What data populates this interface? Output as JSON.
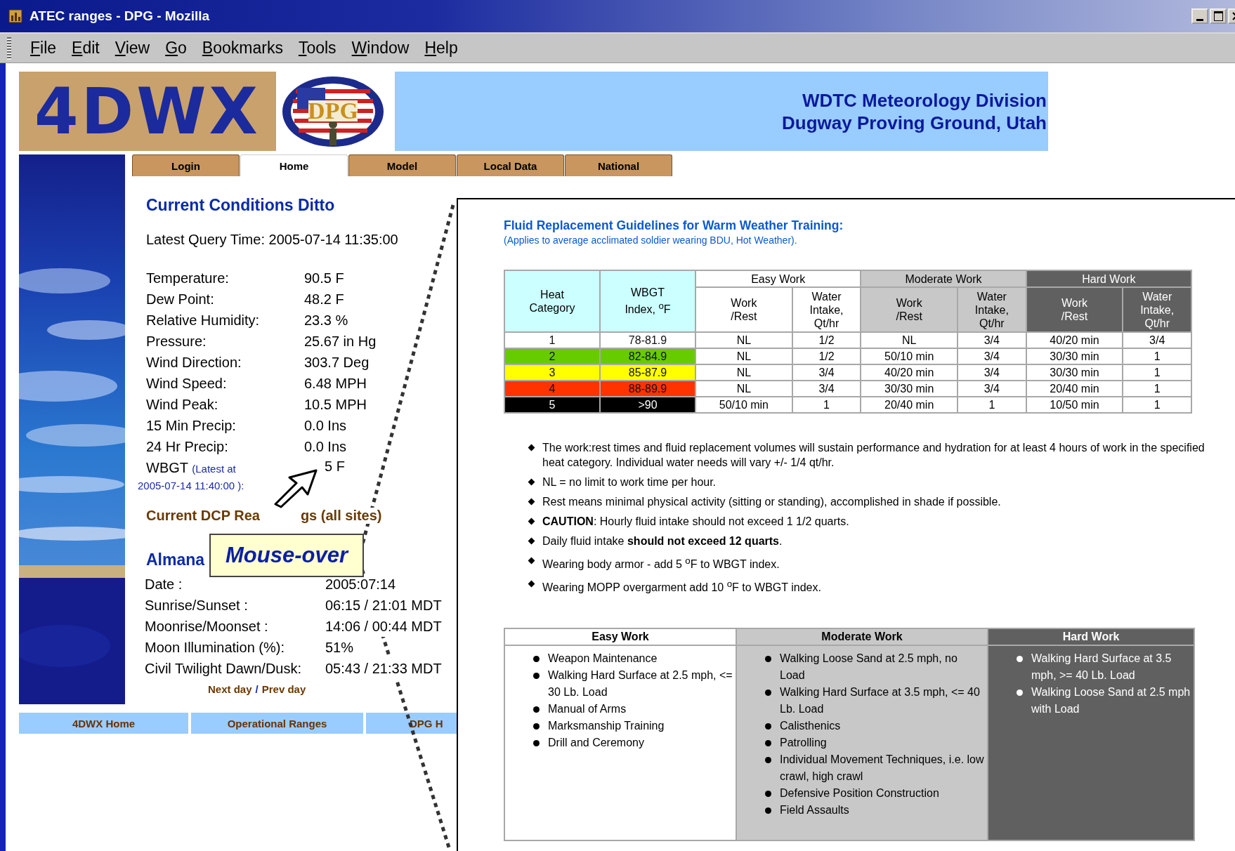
{
  "window": {
    "title": "ATEC ranges - DPG - Mozilla"
  },
  "menu": [
    "File",
    "Edit",
    "View",
    "Go",
    "Bookmarks",
    "Tools",
    "Window",
    "Help"
  ],
  "header": {
    "logo": "4DWX",
    "seal_text": "DPG",
    "banner": [
      "WDTC Meteorology Division",
      "Dugway Proving Ground, Utah"
    ]
  },
  "tabs": [
    {
      "label": "Login",
      "selected": false
    },
    {
      "label": "Home",
      "selected": true
    },
    {
      "label": "Model",
      "selected": false
    },
    {
      "label": "Local Data",
      "selected": false
    },
    {
      "label": "National",
      "selected": false
    }
  ],
  "conditions": {
    "title": "Current Conditions Ditto",
    "query_time": "Latest Query Time: 2005-07-14 11:35:00",
    "rows": [
      {
        "label": "Temperature:",
        "value": "90.5 F"
      },
      {
        "label": "Dew Point:",
        "value": "48.2 F"
      },
      {
        "label": "Relative Humidity:",
        "value": "23.3 %"
      },
      {
        "label": "Pressure:",
        "value": "25.67 in Hg"
      },
      {
        "label": "Wind Direction:",
        "value": "303.7 Deg"
      },
      {
        "label": "Wind Speed:",
        "value": "6.48 MPH"
      },
      {
        "label": "Wind Peak:",
        "value": "10.5 MPH"
      },
      {
        "label": "15 Min Precip:",
        "value": "0.0 Ins"
      },
      {
        "label": "24 Hr Precip:",
        "value": "0.0 Ins"
      }
    ],
    "wbgt": {
      "label": "WBGT",
      "note_line_1": "(Latest at",
      "note_line_2": "2005-07-14 11:40:00 ):",
      "value": "5 F"
    }
  },
  "dcp_heading": [
    "Current DCP Rea",
    "gs (all sites)"
  ],
  "almanac": {
    "title": "Almana",
    "rows": [
      {
        "label": "Date :",
        "value": "2005:07:14"
      },
      {
        "label": "Sunrise/Sunset :",
        "value": "06:15 / 21:01 MDT"
      },
      {
        "label": "Moonrise/Moonset :",
        "value": "14:06 / 00:44 MDT"
      },
      {
        "label": "Moon Illumination (%):",
        "value": "51%"
      },
      {
        "label": "Civil Twilight Dawn/Dusk:",
        "value": "05:43 / 21:33 MDT"
      }
    ],
    "links": [
      "Next day",
      "Prev day"
    ],
    "separator": "/"
  },
  "bottom_nav": [
    "4DWX Home",
    "Operational Ranges",
    "DPG H"
  ],
  "callout": {
    "text": "Mouse-over"
  },
  "popup": {
    "title": "Fluid Replacement Guidelines for Warm Weather Training:",
    "subtitle": "(Applies to average acclimated soldier wearing BDU, Hot Weather).",
    "fluid_table": {
      "lead_columns": [
        "Heat\nCategory",
        "WBGT\nIndex, $^{o}$F"
      ],
      "groups": [
        {
          "name": "Easy Work",
          "color": "#ffffff",
          "columns": [
            "Work\n/Rest",
            "Water\nIntake,\nQt/hr"
          ]
        },
        {
          "name": "Moderate Work",
          "color": "#c8c8c8",
          "columns": [
            "Work\n/Rest",
            "Water\nIntake,\nQt/hr"
          ]
        },
        {
          "name": "Hard Work",
          "color": "#606060",
          "columns": [
            "Work\n/Rest",
            "Water\nIntake,\nQt/hr"
          ]
        }
      ],
      "rows": [
        {
          "category": "1",
          "wbgt": "78-81.9",
          "color": "#ffffff",
          "values": [
            "NL",
            "1/2",
            "NL",
            "3/4",
            "40/20 min",
            "3/4"
          ]
        },
        {
          "category": "2",
          "wbgt": "82-84.9",
          "color": "#66cc00",
          "values": [
            "NL",
            "1/2",
            "50/10 min",
            "3/4",
            "30/30 min",
            "1"
          ]
        },
        {
          "category": "3",
          "wbgt": "85-87.9",
          "color": "#ffff00",
          "values": [
            "NL",
            "3/4",
            "40/20 min",
            "3/4",
            "30/30 min",
            "1"
          ]
        },
        {
          "category": "4",
          "wbgt": "88-89.9",
          "color": "#ff3300",
          "values": [
            "NL",
            "3/4",
            "30/30 min",
            "3/4",
            "20/40 min",
            "1"
          ]
        },
        {
          "category": "5",
          "wbgt": ">90",
          "color": "#000000",
          "values": [
            "50/10 min",
            "1",
            "20/40 min",
            "1",
            "10/50 min",
            "1"
          ]
        }
      ]
    },
    "notes": [
      "The work:rest times and fluid replacement volumes will sustain performance and hydration for at least 4 hours of work in the specified heat category. Individual water needs will vary +/- 1/4 qt/hr.",
      "NL = no limit to work time per hour.",
      "Rest means minimal physical activity (sitting or standing), accomplished in shade if possible.",
      "**CAUTION**: Hourly fluid intake should not exceed 1 1/2 quarts.",
      "Daily fluid intake **should not exceed 12 quarts**.",
      "Wearing body armor - add 5 $^{o}$F to WBGT index.",
      "Wearing MOPP overgarment add 10 $^{o}$F to WBGT index."
    ],
    "activities_table": {
      "columns": [
        {
          "name": "Easy Work",
          "color": "#ffffff",
          "items": [
            "Weapon Maintenance",
            "Walking Hard Surface at 2.5 mph, <= 30 Lb. Load",
            "Manual of Arms",
            "Marksmanship Training",
            "Drill and Ceremony"
          ]
        },
        {
          "name": "Moderate Work",
          "color": "#c8c8c8",
          "items": [
            "Walking Loose Sand at 2.5 mph, no Load",
            "Walking Hard Surface at 3.5 mph, <= 40 Lb. Load",
            "Calisthenics",
            "Patrolling",
            "Individual Movement Techniques, i.e. low crawl, high crawl",
            "Defensive Position Construction",
            "Field Assaults"
          ]
        },
        {
          "name": "Hard Work",
          "color": "#606060",
          "items": [
            "Walking Hard Surface at 3.5 mph, >= 40 Lb. Load",
            "Walking Loose Sand at 2.5 mph with Load"
          ]
        }
      ]
    }
  }
}
